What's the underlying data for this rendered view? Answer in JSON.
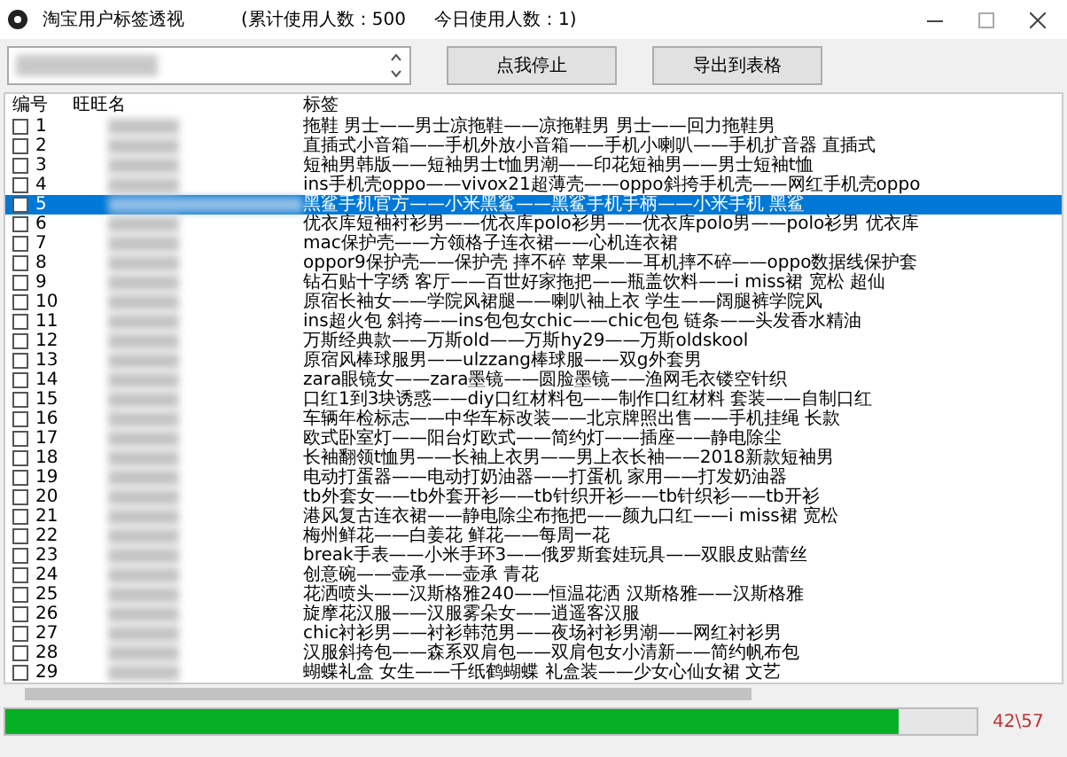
{
  "window": {
    "title": "淘宝用户标签透视",
    "total_users": "(累计使用人数：500",
    "today_users": "今日使用人数：1)"
  },
  "toolbar": {
    "buttons": [
      "点我停止",
      "导出到表格"
    ]
  },
  "table": {
    "columns": [
      "编号",
      "旺旺名",
      "标签"
    ],
    "rows": [
      {
        "no": "1",
        "checked": false,
        "selected": false,
        "tags": "拖鞋 男士——男士凉拖鞋——凉拖鞋男 男士——回力拖鞋男"
      },
      {
        "no": "2",
        "checked": false,
        "selected": false,
        "tags": "直插式小音箱——手机外放小音箱——手机小喇叭——手机扩音器 直插式"
      },
      {
        "no": "3",
        "checked": false,
        "selected": false,
        "tags": "短袖男韩版——短袖男士t恤男潮——印花短袖男——男士短袖t恤"
      },
      {
        "no": "4",
        "checked": false,
        "selected": false,
        "tags": "ins手机壳oppo——vivox21超薄壳——oppo斜挎手机壳——网红手机壳oppo"
      },
      {
        "no": "5",
        "checked": false,
        "selected": true,
        "tags": "黑鲨手机官方——小米黑鲨——黑鲨手机手柄——小米手机 黑鲨"
      },
      {
        "no": "6",
        "checked": false,
        "selected": false,
        "tags": "优衣库短袖衬衫男——优衣库polo衫男——优衣库polo男——polo衫男 优衣库"
      },
      {
        "no": "7",
        "checked": false,
        "selected": false,
        "tags": "mac保护壳——方领格子连衣裙——心机连衣裙"
      },
      {
        "no": "8",
        "checked": false,
        "selected": false,
        "tags": "oppor9保护壳——保护壳 摔不碎 苹果——耳机摔不碎——oppo数据线保护套"
      },
      {
        "no": "9",
        "checked": false,
        "selected": false,
        "tags": "钻石贴十字绣 客厅——百世好家拖把——瓶盖饮料——i miss裙 宽松 超仙"
      },
      {
        "no": "10",
        "checked": false,
        "selected": false,
        "tags": "原宿长袖女——学院风裙腿——喇叭袖上衣 学生——阔腿裤学院风"
      },
      {
        "no": "11",
        "checked": false,
        "selected": false,
        "tags": "ins超火包 斜挎——ins包包女chic——chic包包 链条——头发香水精油"
      },
      {
        "no": "12",
        "checked": false,
        "selected": false,
        "tags": "万斯经典款——万斯old——万斯hy29——万斯oldskool"
      },
      {
        "no": "13",
        "checked": false,
        "selected": false,
        "tags": "原宿风棒球服男——ulzzang棒球服——双g外套男"
      },
      {
        "no": "14",
        "checked": false,
        "selected": false,
        "tags": "zara眼镜女——zara墨镜——圆脸墨镜——渔网毛衣镂空针织"
      },
      {
        "no": "15",
        "checked": false,
        "selected": false,
        "tags": "口红1到3块诱惑——diy口红材料包——制作口红材料 套装——自制口红"
      },
      {
        "no": "16",
        "checked": false,
        "selected": false,
        "tags": "车辆年检标志——中华车标改装——北京牌照出售——手机挂绳 长款"
      },
      {
        "no": "17",
        "checked": false,
        "selected": false,
        "tags": "欧式卧室灯——阳台灯欧式——简约灯——插座——静电除尘"
      },
      {
        "no": "18",
        "checked": false,
        "selected": false,
        "tags": "长袖翻领t恤男——长袖上衣男——男上衣长袖——2018新款短袖男"
      },
      {
        "no": "19",
        "checked": false,
        "selected": false,
        "tags": "电动打蛋器——电动打奶油器——打蛋机 家用——打发奶油器"
      },
      {
        "no": "20",
        "checked": false,
        "selected": false,
        "tags": "tb外套女——tb外套开衫——tb针织开衫——tb针织衫——tb开衫"
      },
      {
        "no": "21",
        "checked": false,
        "selected": false,
        "tags": "港风复古连衣裙——静电除尘布拖把——颜九口红——i miss裙 宽松"
      },
      {
        "no": "22",
        "checked": false,
        "selected": false,
        "tags": "梅州鲜花——白姜花 鲜花——每周一花"
      },
      {
        "no": "23",
        "checked": false,
        "selected": false,
        "tags": "break手表——小米手环3——俄罗斯套娃玩具——双眼皮贴蕾丝"
      },
      {
        "no": "24",
        "checked": false,
        "selected": false,
        "tags": "创意碗——壶承——壶承 青花"
      },
      {
        "no": "25",
        "checked": false,
        "selected": false,
        "tags": "花洒喷头——汉斯格雅240——恒温花洒 汉斯格雅——汉斯格雅"
      },
      {
        "no": "26",
        "checked": false,
        "selected": false,
        "tags": "旋摩花汉服——汉服雾朵女——逍遥客汉服"
      },
      {
        "no": "27",
        "checked": false,
        "selected": false,
        "tags": "chic衬衫男——衬衫韩范男——夜场衬衫男潮——网红衬衫男"
      },
      {
        "no": "28",
        "checked": false,
        "selected": false,
        "tags": "汉服斜挎包——森系双肩包——双肩包女小清新——简约帆布包"
      },
      {
        "no": "29",
        "checked": false,
        "selected": false,
        "tags": "蝴蝶礼盒 女生——千纸鹤蝴蝶 礼盒装——少女心仙女裙 文艺"
      }
    ]
  },
  "progress": {
    "level": 0.92,
    "reading": "42\\57"
  }
}
